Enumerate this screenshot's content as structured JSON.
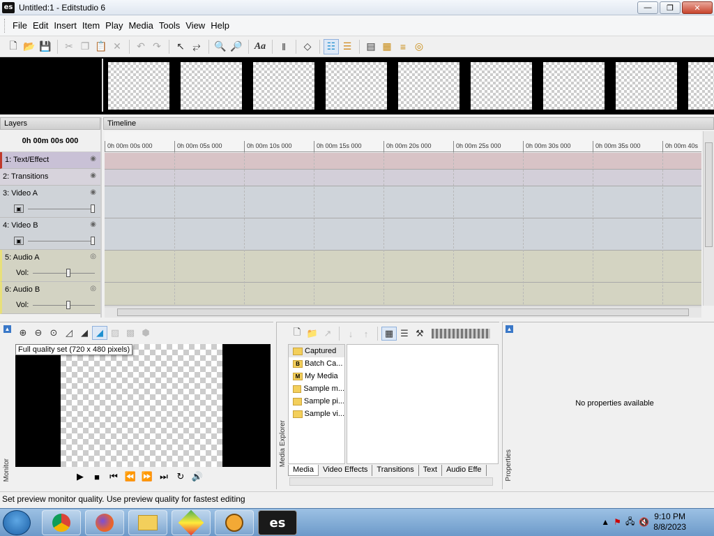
{
  "window": {
    "title": "Untitled:1 - Editstudio 6",
    "logo": "es"
  },
  "menu": [
    "File",
    "Edit",
    "Insert",
    "Item",
    "Play",
    "Media",
    "Tools",
    "View",
    "Help"
  ],
  "layers": {
    "header": "Layers",
    "time": "0h 00m 00s 000",
    "items": [
      {
        "label": "1: Text/Effect",
        "color": "#c9c1d6"
      },
      {
        "label": "2: Transitions",
        "color": "#d7d3dc"
      },
      {
        "label": "3: Video A",
        "color": "#cfd3d8"
      },
      {
        "label": "4: Video B",
        "color": "#cfd3d8"
      },
      {
        "label": "5: Audio A",
        "color": "#d3d3c3",
        "sub_label": "Vol:"
      },
      {
        "label": "6: Audio B",
        "color": "#d3d3c3",
        "sub_label": "Vol:"
      }
    ]
  },
  "timeline": {
    "header": "Timeline",
    "ticks": [
      "0h 00m 00s 000",
      "0h 00m 05s 000",
      "0h 00m 10s 000",
      "0h 00m 15s 000",
      "0h 00m 20s 000",
      "0h 00m 25s 000",
      "0h 00m 30s 000",
      "0h 00m 35s 000",
      "0h 00m 40s"
    ]
  },
  "monitor": {
    "tooltip": "Full quality set (720 x 480 pixels)",
    "label": "Monitor"
  },
  "media": {
    "label": "Media Explorer",
    "items": [
      {
        "label": "Captured",
        "badge": ""
      },
      {
        "label": "Batch Ca...",
        "badge": "B"
      },
      {
        "label": "My Media",
        "badge": "M"
      },
      {
        "label": "Sample m...",
        "badge": ""
      },
      {
        "label": "Sample pi...",
        "badge": ""
      },
      {
        "label": "Sample vi...",
        "badge": ""
      }
    ],
    "tabs": [
      "Media",
      "Video Effects",
      "Transitions",
      "Text",
      "Audio Effe"
    ]
  },
  "properties": {
    "label": "Properties",
    "empty": "No properties available"
  },
  "status": "Set preview monitor quality. Use preview quality for fastest editing",
  "taskbar": {
    "time": "9:10 PM",
    "date": "8/8/2023",
    "apps": [
      "chrome",
      "firefox",
      "file-explorer",
      "bluestacks",
      "app-4",
      "editstudio"
    ]
  },
  "colors": {
    "layer_text_effect": "#c9c1d6",
    "layer_video": "#cfd3d8",
    "layer_audio": "#d3d3c3",
    "accent": "#3a78c8"
  }
}
